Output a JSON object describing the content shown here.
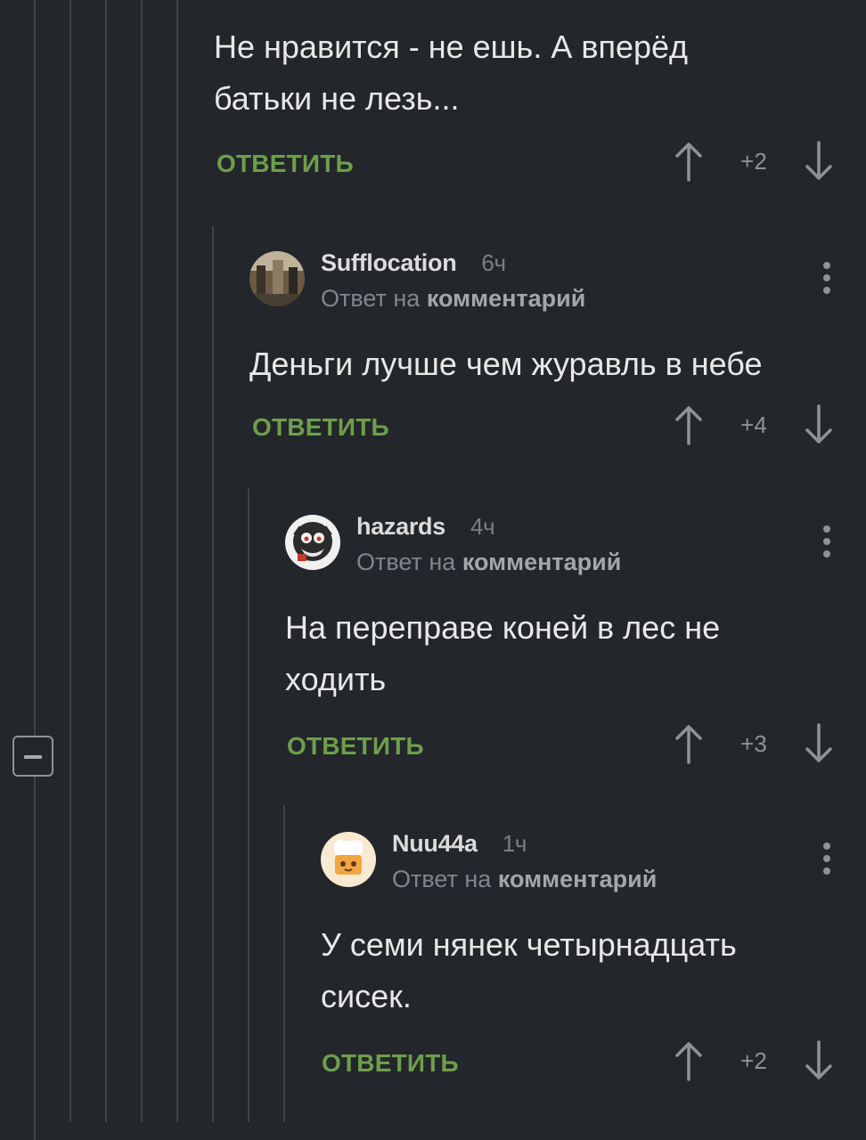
{
  "comments": [
    {
      "text": "Не нравится - не ешь. А вперёд батьки не лезь...",
      "reply_label": "ОТВЕТИТЬ",
      "score": "+2"
    },
    {
      "username": "Sufflocation",
      "time": "6ч",
      "reply_prefix": "Ответ на",
      "reply_target": "комментарий",
      "text": "Деньги лучше чем журавль в небе",
      "reply_label": "ОТВЕТИТЬ",
      "score": "+4"
    },
    {
      "username": "hazards",
      "time": "4ч",
      "reply_prefix": "Ответ на",
      "reply_target": "комментарий",
      "text": "На переправе коней в лес не ходить",
      "reply_label": "ОТВЕТИТЬ",
      "score": "+3"
    },
    {
      "username": "Nuu44a",
      "time": "1ч",
      "reply_prefix": "Ответ на",
      "reply_target": "комментарий",
      "text": "У семи нянек четырнадцать сисек.",
      "reply_label": "ОТВЕТИТЬ",
      "score": "+2"
    }
  ],
  "icons": {
    "collapse": "minus-square-icon",
    "upvote": "arrow-up-icon",
    "downvote": "arrow-down-icon",
    "menu": "more-vertical-icon"
  },
  "colors": {
    "background": "#23262a",
    "reply": "#6e9e4b",
    "thread_line": "#3f4347"
  }
}
